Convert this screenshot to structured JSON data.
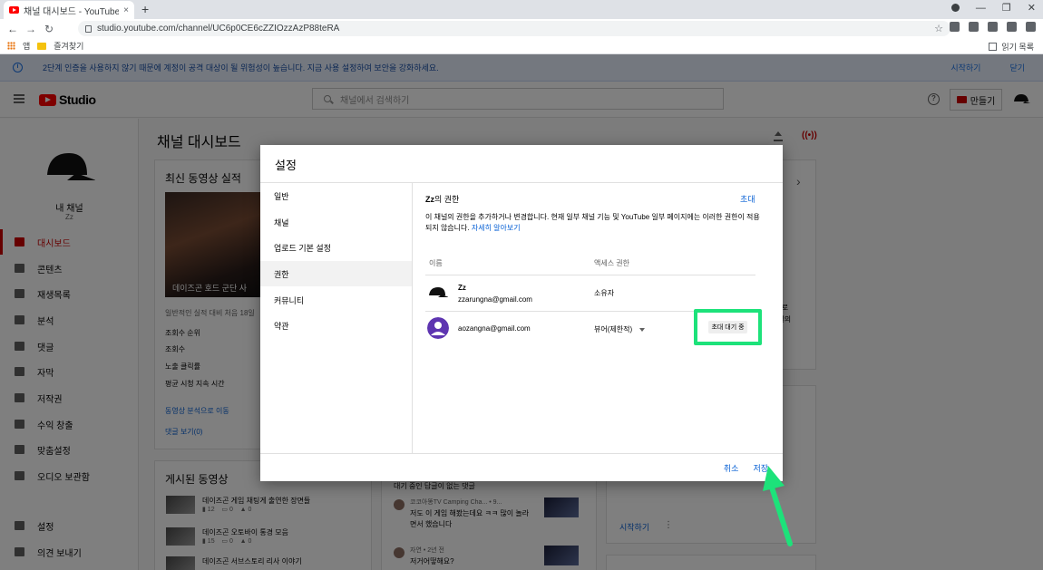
{
  "browser": {
    "tab_title": "채널 대시보드 - YouTube Studio",
    "tab_close": "×",
    "new_tab": "+",
    "url": "studio.youtube.com/channel/UC6p0CE6cZZIOzzAzP88teRA",
    "bookmarks": [
      "앱",
      "즐겨찾기"
    ],
    "reading_list": "읽기 목록",
    "nav": {
      "back": "←",
      "forward": "→",
      "reload": "↻"
    },
    "star": "☆",
    "window": {
      "minimize": "—",
      "maximize": "❐",
      "close": "✕"
    }
  },
  "banner": {
    "text": "2단계 인증을 사용하지 않기 때문에 계정이 공격 대상이 될 위험성이 높습니다. 지금 사용 설정하여 보안을 강화하세요.",
    "start": "시작하기",
    "close": "닫기",
    "info_glyph": "i"
  },
  "topbar": {
    "logo_text": "Studio",
    "search_placeholder": "채널에서 검색하기",
    "create": "만들기",
    "help_glyph": "?"
  },
  "sidebar": {
    "channel_label": "내 채널",
    "channel_name": "Zz",
    "items": [
      {
        "label": "대시보드",
        "active": true
      },
      {
        "label": "콘텐츠"
      },
      {
        "label": "재생목록"
      },
      {
        "label": "분석"
      },
      {
        "label": "댓글"
      },
      {
        "label": "자막"
      },
      {
        "label": "저작권"
      },
      {
        "label": "수익 창출"
      },
      {
        "label": "맞춤설정"
      },
      {
        "label": "오디오 보관함"
      },
      {
        "label": "설정"
      },
      {
        "label": "의견 보내기"
      }
    ]
  },
  "main": {
    "title": "채널 대시보드",
    "latest_card": {
      "title": "최신 동영상 실적",
      "thumb_caption": "데이즈곤 호드 군단 사",
      "comparison": "일반적인 실적 대비 처음 18일",
      "rows": [
        "조회수 순위",
        "조회수",
        "노출 클릭률",
        "평균 시청 지속 시간"
      ],
      "analytics_link": "동영상 분석으로 이동",
      "comments_link": "댓글 보기(0)"
    },
    "published_card": {
      "title": "게시된 동영상",
      "videos": [
        {
          "title": "데이즈곤 게임 채팅게 출연한 장면들",
          "views": "12",
          "comments": "0",
          "likes": "0"
        },
        {
          "title": "데이즈곤 오토바이 통경 모음",
          "views": "15",
          "comments": "0",
          "likes": "0"
        },
        {
          "title": "데이즈곤 서브스토리 리사 이야기",
          "views": "",
          "comments": "",
          "likes": ""
        }
      ]
    },
    "comments_card": {
      "title": "대기 중인 답글이 없는 댓글",
      "items": [
        {
          "author": "코코아똥TV Camping Cha...",
          "extra": "• 9...",
          "text_line1": "저도 이 게임 해봤는데요 ㅋㅋ 많이 놀라",
          "text_line2": "면서 했습니다"
        },
        {
          "author": "자연",
          "extra": "• 2년 전",
          "text_line1": "저거어떻해요?",
          "text_line2": ""
        }
      ]
    },
    "right_fragments": [
      "2으로",
      "채널의"
    ],
    "start_link": "시작하기",
    "kebab": "⋮",
    "chevron": "›"
  },
  "dialog": {
    "title": "설정",
    "nav": [
      "일반",
      "채널",
      "업로드 기본 설정",
      "권한",
      "커뮤니티",
      "약관"
    ],
    "active_nav": "권한",
    "perm_owner": "Zz",
    "perm_title_suffix": "의 권한",
    "invite": "초대",
    "desc": "이 채널의 권한을 추가하거나 변경합니다. 현재 일부 채널 기능 및 YouTube 일부 페이지에는 이러한 권한이 적용되지 않습니다.",
    "learn_more": "자세히 알아보기",
    "col_name": "이름",
    "col_access": "액세스 권한",
    "members": [
      {
        "name": "Zz",
        "email": "zzarungna@gmail.com",
        "access": "소유자"
      },
      {
        "email": "aozangna@gmail.com",
        "access": "뷰어(제한적)",
        "status": "초대 대기 중"
      }
    ],
    "cancel": "취소",
    "save": "저장"
  },
  "colors": {
    "highlight_box": "#1de27a",
    "arrow": "#1de27a",
    "link": "#065fd4",
    "active_red": "#cc0000",
    "member_avatar": "#5e35b1"
  }
}
